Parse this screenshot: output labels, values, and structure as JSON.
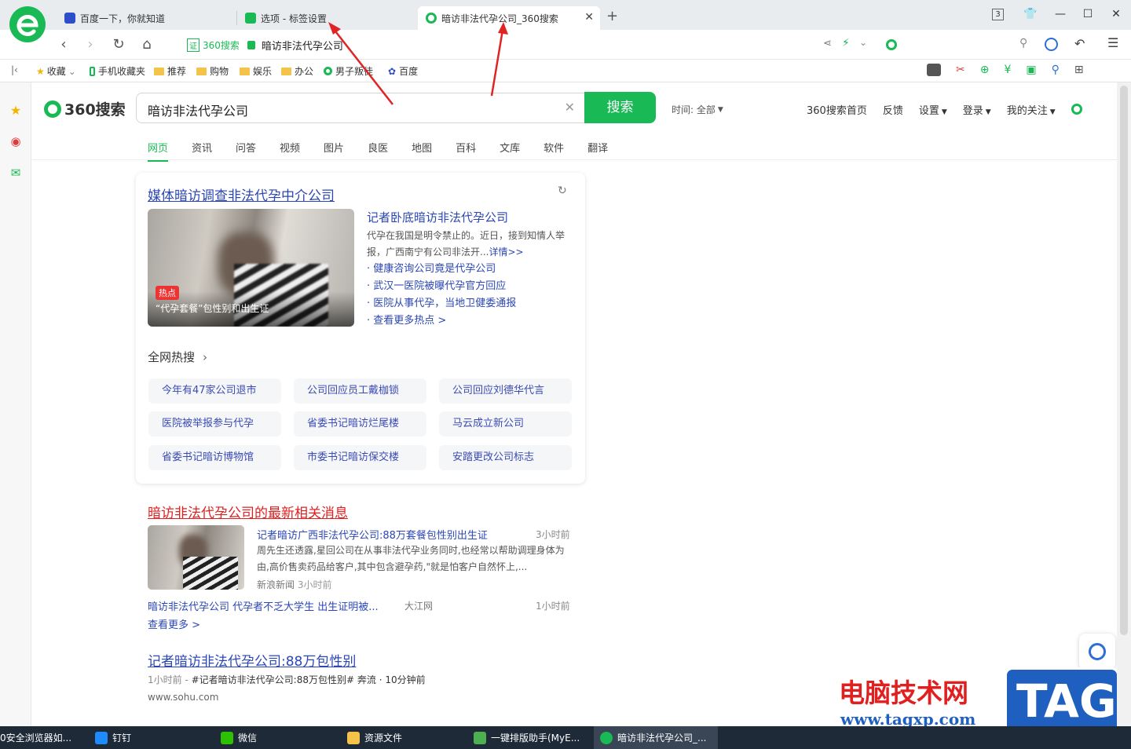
{
  "tabs": [
    {
      "label": "百度一下，你就知道"
    },
    {
      "label": "选项 - 标签设置"
    },
    {
      "label": "暗访非法代孕公司_360搜索"
    }
  ],
  "window": {
    "tab_count": "3"
  },
  "address": {
    "site_label": "360搜索",
    "url_text": "暗访非法代孕公司"
  },
  "favorites": [
    {
      "label": "收藏"
    },
    {
      "label": "手机收藏夹"
    },
    {
      "label": "推荐"
    },
    {
      "label": "购物"
    },
    {
      "label": "娱乐"
    },
    {
      "label": "办公"
    },
    {
      "label": "男子叛徒"
    },
    {
      "label": "百度"
    }
  ],
  "search": {
    "logo": "360搜索",
    "query": "暗访非法代孕公司",
    "button": "搜索",
    "time_filter": "时间: 全部"
  },
  "top_links": [
    {
      "label": "360搜索首页"
    },
    {
      "label": "反馈"
    },
    {
      "label": "设置"
    },
    {
      "label": "登录"
    },
    {
      "label": "我的关注"
    }
  ],
  "nav": [
    {
      "label": "网页"
    },
    {
      "label": "资讯"
    },
    {
      "label": "问答"
    },
    {
      "label": "视频"
    },
    {
      "label": "图片"
    },
    {
      "label": "良医"
    },
    {
      "label": "地图"
    },
    {
      "label": "百科"
    },
    {
      "label": "文库"
    },
    {
      "label": "软件"
    },
    {
      "label": "翻译"
    }
  ],
  "card": {
    "title": "媒体暗访调查非法代孕中介公司",
    "image_badge": "热点",
    "image_caption": "“代孕套餐”包性别和出生证",
    "headline": "记者卧底暗访非法代孕公司",
    "summary": "代孕在我国是明令禁止的。近日，接到知情人举报，广西南宁有公司非法开...",
    "summary_more": "详情>>",
    "bullets": [
      {
        "text": "健康咨询公司竟是代孕公司"
      },
      {
        "text": "武汉一医院被曝代孕官方回应"
      },
      {
        "text": "医院从事代孕，当地卫健委通报"
      },
      {
        "text": "查看更多热点 >"
      }
    ],
    "hot_title": "全网热搜",
    "hot_items": [
      {
        "text": "今年有47家公司退市"
      },
      {
        "text": "公司回应员工戴枷锁"
      },
      {
        "text": "公司回应刘德华代言"
      },
      {
        "text": "医院被举报参与代孕"
      },
      {
        "text": "省委书记暗访烂尾楼"
      },
      {
        "text": "马云成立新公司"
      },
      {
        "text": "省委书记暗访博物馆"
      },
      {
        "text": "市委书记暗访保交楼"
      },
      {
        "text": "安踏更改公司标志"
      }
    ]
  },
  "news": {
    "title": "暗访非法代孕公司的最新相关消息",
    "item_title": "记者暗访广西非法代孕公司:88万套餐包性别出生证",
    "item_time": "3小时前",
    "item_desc": "周先生还透露,星回公司在从事非法代孕业务同时,也经常以帮助调理身体为由,高价售卖药品给客户,其中包含避孕药,\"就是怕客户自然怀上,...",
    "item_source": "新浪新闻",
    "item_source_time": "3小时前",
    "second_title": "暗访非法代孕公司 代孕者不乏大学生 出生证明被...",
    "second_source": "大江网",
    "second_time": "1小时前",
    "more": "查看更多 >"
  },
  "result": {
    "title": "记者暗访非法代孕公司:88万包性别",
    "meta_time": "1小时前 - ",
    "meta_tag": "#记者暗访非法代孕公司:88万包性别#",
    "meta_author": "奔流",
    "meta_ago": "10分钟前",
    "url": "www.sohu.com"
  },
  "watermark": {
    "site": "电脑技术网",
    "url": "www.tagxp.com",
    "logo": "TAG"
  },
  "taskbar": [
    {
      "label": "0安全浏览器如..."
    },
    {
      "label": "钉钉"
    },
    {
      "label": "微信"
    },
    {
      "label": "资源文件"
    },
    {
      "label": "一键排版助手(MyE..."
    },
    {
      "label": "暗访非法代孕公司_..."
    }
  ],
  "colors": {
    "brand_green": "#19b955",
    "link_blue": "#2b47b5",
    "highlight_red": "#e02020",
    "arrow_red": "#e02424"
  }
}
